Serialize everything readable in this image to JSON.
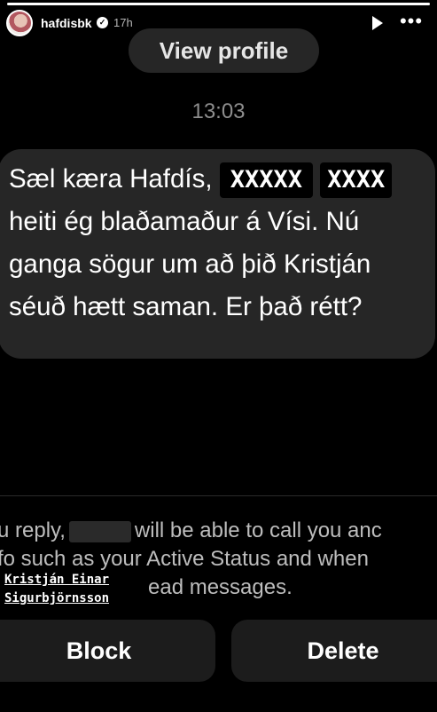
{
  "story": {
    "progress": 1.0
  },
  "header": {
    "username": "hafdisbk",
    "time_ago": "17h",
    "verified_glyph": "✓"
  },
  "view_profile_label": "View profile",
  "timestamp": "13:03",
  "message": {
    "part1": "Sæl kæra Hafdís,",
    "redact1": "XXXXX",
    "redact2": "XXXX",
    "part2": "heiti ég blaðamaður á Vísi. Nú ganga sögur um að þið Kristján séuð hætt saman. Er það rétt?"
  },
  "notice": {
    "line1_a": "u reply,",
    "line1_b": "will be able to call you anc",
    "line2": "fo such as your Active Status and when",
    "line3": "ead messages."
  },
  "overlay": {
    "line1": "Kristján Einar",
    "line2": "Sigurbjörnsson"
  },
  "buttons": {
    "block": "Block",
    "delete": "Delete"
  }
}
